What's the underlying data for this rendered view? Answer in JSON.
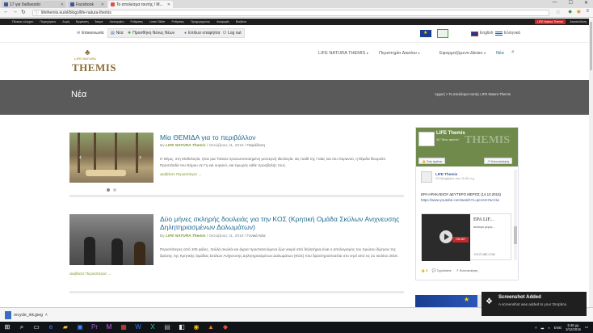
{
  "browser": {
    "tabs": [
      {
        "label": "17 για διαδικασία",
        "color": "#3b5998"
      },
      {
        "label": "Facebook",
        "color": "#3b5998"
      },
      {
        "label": "Το απολέσμα τουτής / Μ...",
        "color": "#d9534f"
      }
    ],
    "url": "lifethemis.eu/el/blogs/life-natura-themis",
    "window_controls": {
      "minimize": "—",
      "maximize": "☐",
      "close": "✕"
    }
  },
  "site_topbar": {
    "items": [
      "Πίνακας ελέγχου",
      "Περιεχόμενο",
      "Δομή",
      "Εμφάνιση",
      "Άτομα",
      "Λειτουργίες",
      "Ρυθμίσεις",
      "Learn Slider",
      "Ρυθμίσεις",
      "Προχωρημένες",
      "Αναφορές",
      "Βοήθεια"
    ],
    "lang_button": "LIFE Natura Themis",
    "right_item": "Αποσύνδεση"
  },
  "utility": {
    "contact_label": "Επικοινωνία",
    "news_label": "Νέα",
    "add_news_label": "Προσθήκη Νέους Νέων",
    "edit_label": "Επίλυσ επαφή/σα",
    "logout_label": "Log out",
    "lang_en": "English",
    "lang_el": "Ελληνικά"
  },
  "header": {
    "logo_subtitle": "LIFE NATURA",
    "logo_title": "THEMIS",
    "nav": [
      {
        "label": "LIFE NATURA THEMIS",
        "caret": true
      },
      {
        "label": "Περιστηρίο Δικαίου",
        "caret": true
      },
      {
        "label": "Εφαρμοζόμενο Δίκαιο",
        "caret": true
      },
      {
        "label": "Νέα",
        "caret": false
      }
    ],
    "nav_active_color": "#1f6b8f"
  },
  "banner": {
    "title": "Νέα",
    "breadcrumb": "Αρχική > Το απολέσμα τουτής LIFE Natura Themis"
  },
  "posts": [
    {
      "title": "Μία ΘΕΜΙΔΑ για το περιβάλλον",
      "by": "By",
      "author": "LIFE NATURA Themis",
      "date": "Οκτώβριος 11, 2016",
      "category": "Παράδοση",
      "excerpt": "Η Θέμις, στη Μυθολογία, ήταν μια Τιτάνια προσωποποιημένη μοντερνή ιδεολογία. Ως παιδί της Γαίας και του Ουρανού, η θέμιδα θεωρείτο Προστάτιδα του Νόμου σε Γη και ουρανό, και τιμωρός κάθε προσβολής τους.",
      "readmore": "Διαβάστε Περισσότερα →"
    },
    {
      "title": "Δύο μήνες σκληρής δουλειάς για την ΚΟΣ (Κρητική Ομάδα Σκύλων Ανιχνευσης Δηλητηριασμένων Δολωμάτων)",
      "by": "By",
      "author": "LIFE NATURA Themis",
      "date": "Οκτώβριος 11, 2016",
      "category": "Γενικά Νέα",
      "excerpt": "Περισσότερες από 105 φόλες, πολλά σκυλιά και άγρια προστατευόμενα ζώα νεκρά από δηλητήρια είναι ο απολογισμός του πρώτου δίμηνου της δράσης της Κρητικής Ομάδας Σκύλων Ανίχνευσης Δηλητηριασμένων Δολωμάτων (ΚΟΣ) που δραστηριοποιείται στο νησί από τις 21 Ιουλίου 2016.",
      "readmore": "Διαβάστε Περισσότερα →"
    }
  ],
  "facebook": {
    "page_name": "LIFE Themis",
    "likes": "40 \"Μου αρέσει\"",
    "like_button": "Σας αρέσει",
    "share_button": "Κοινοποίηση",
    "post_author": "LIFE Themis",
    "post_time": "23 Νοεμβρίου στις 11:39 π.μ.",
    "post_text": "ΕΡΑ ΗΡΑΚΛΕΙΟΥ ΔΕΥΤΕΡΟ ΜΕΡΟΣ (14.10.2016)",
    "post_link": "https://www.youtube.com/watch?v=pecXm7acCiw",
    "media_title": "ΕΡΑ LIF...",
    "media_sub": "Δεύτερο μέρος...",
    "media_site": "YOUTUBE.COM",
    "media_badge": "ON AIR",
    "footer_likes": "2",
    "footer_comment": "Σχολιάστε",
    "footer_share": "Κοινοποίηση",
    "watermark": "THEMIS"
  },
  "downloads": {
    "file": "recycle_ink.jpeg"
  },
  "toast": {
    "title": "Screenshot Added",
    "message": "A screenshot was added to your Dropbox."
  },
  "taskbar": {
    "lang": "ENG",
    "time": "5:48 μμ",
    "date": "2/12/2016"
  }
}
